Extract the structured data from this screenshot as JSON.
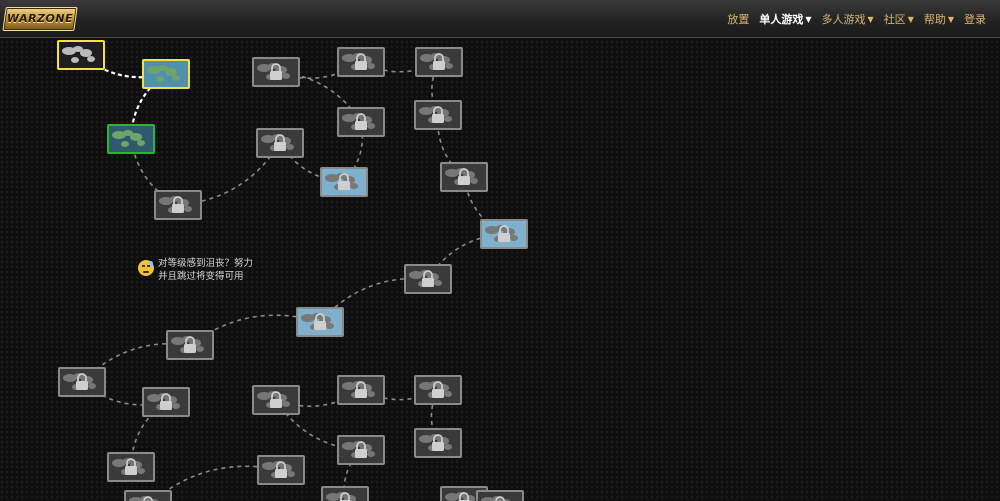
{
  "brand": {
    "logo_text": "WARZONE"
  },
  "nav": {
    "items": [
      {
        "label": "放置",
        "dropdown": false,
        "active": false
      },
      {
        "label": "单人游戏",
        "dropdown": true,
        "active": true
      },
      {
        "label": "多人游戏",
        "dropdown": true,
        "active": false
      },
      {
        "label": "社区",
        "dropdown": true,
        "active": false
      },
      {
        "label": "帮助",
        "dropdown": true,
        "active": false
      },
      {
        "label": "登录",
        "dropdown": false,
        "active": false
      }
    ]
  },
  "note": {
    "icon": "sad-face-icon",
    "line1": "对等级感到沮丧？努力",
    "line2": "并且跳过将变得可用"
  },
  "colors": {
    "highlight_current": "#f2e23a",
    "highlight_completed": "#2db52d",
    "locked_border": "#8a8a8a",
    "nav_text": "#d8b66a",
    "path_active": "#ffffff",
    "path_locked": "#8a8a8a"
  },
  "levels": [
    {
      "id": "level-1",
      "status": "current"
    },
    {
      "id": "level-2",
      "status": "current"
    },
    {
      "id": "level-3",
      "status": "completed"
    },
    {
      "id": "level-4",
      "status": "locked"
    },
    {
      "id": "level-5",
      "status": "locked"
    },
    {
      "id": "level-6",
      "status": "locked"
    },
    {
      "id": "level-7",
      "status": "locked"
    },
    {
      "id": "level-8",
      "status": "locked"
    },
    {
      "id": "level-9",
      "status": "locked"
    },
    {
      "id": "level-10",
      "status": "locked"
    },
    {
      "id": "level-11",
      "status": "locked"
    },
    {
      "id": "level-12",
      "status": "locked"
    },
    {
      "id": "level-13",
      "status": "locked"
    },
    {
      "id": "level-14",
      "status": "locked"
    },
    {
      "id": "level-15",
      "status": "locked"
    },
    {
      "id": "level-16",
      "status": "locked"
    },
    {
      "id": "level-17",
      "status": "locked"
    },
    {
      "id": "level-18",
      "status": "locked"
    },
    {
      "id": "level-19",
      "status": "locked"
    },
    {
      "id": "level-20",
      "status": "locked"
    },
    {
      "id": "level-21",
      "status": "locked"
    },
    {
      "id": "level-22",
      "status": "locked"
    },
    {
      "id": "level-23",
      "status": "locked"
    },
    {
      "id": "level-24",
      "status": "locked"
    },
    {
      "id": "level-25",
      "status": "locked"
    },
    {
      "id": "level-26",
      "status": "locked"
    },
    {
      "id": "level-27",
      "status": "locked"
    },
    {
      "id": "level-28",
      "status": "locked"
    },
    {
      "id": "level-29",
      "status": "locked"
    }
  ]
}
